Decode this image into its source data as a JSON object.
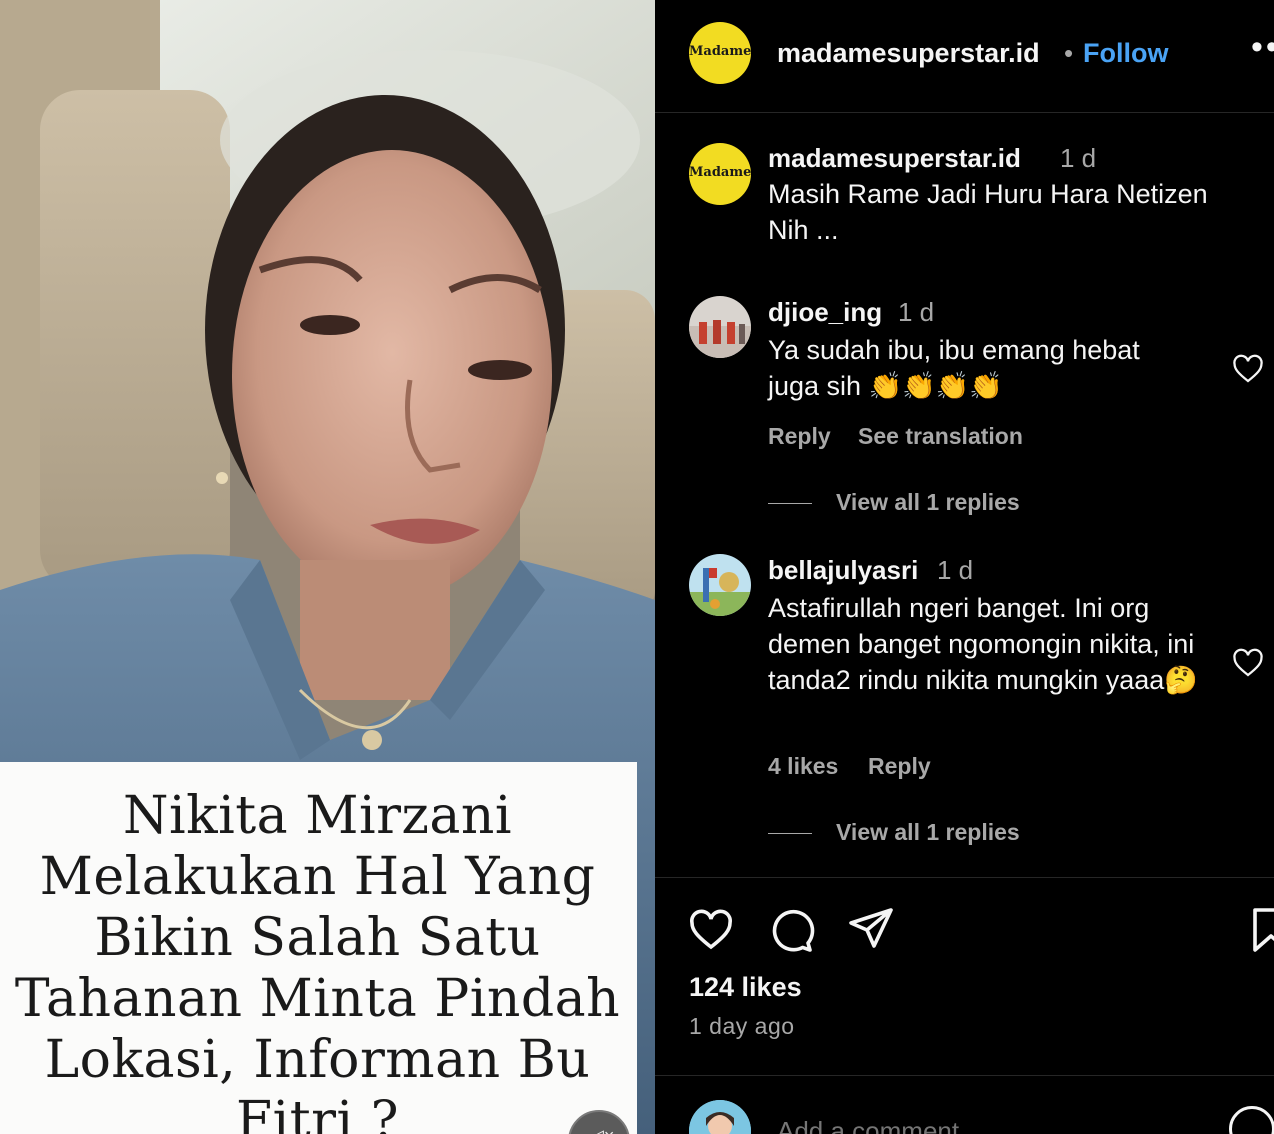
{
  "media": {
    "caption_card_text": "Nikita Mirzani\nMelakukan Hal Yang\nBikin Salah Satu\nTahanan Minta Pindah\nLokasi, Informan Bu\nFitri ?"
  },
  "header": {
    "logo_text": "Madame",
    "username": "madamesuperstar.id",
    "separator": "•",
    "follow_label": "Follow",
    "more_label": "••"
  },
  "post_caption": {
    "username": "madamesuperstar.id",
    "time": "1 d",
    "text": "Masih Rame Jadi Huru Hara Netizen Nih ..."
  },
  "comments": [
    {
      "username": "djioe_ing",
      "time": "1 d",
      "text": "Ya sudah ibu, ibu emang hebat juga sih 👏👏👏👏",
      "actions": [
        "Reply",
        "See translation"
      ],
      "view_replies": "View all 1 replies"
    },
    {
      "username": "bellajulyasri",
      "time": "1 d",
      "text": "Astafirullah ngeri banget. Ini org demen banget ngomongin nikita, ini tanda2 rindu nikita mungkin yaaa🤔",
      "actions": [
        "4 likes",
        "Reply"
      ],
      "view_replies": "View all 1 replies"
    }
  ],
  "actions_bar": {
    "icons": [
      "heart-icon",
      "comment-icon",
      "share-icon",
      "bookmark-icon"
    ],
    "likes": "124 likes",
    "posted": "1 day ago"
  },
  "composer": {
    "placeholder": "Add a comment..."
  },
  "colors": {
    "background": "#000000",
    "accent": "#4aa3f5",
    "muted": "#a8a8a8",
    "logo_yellow": "#f2dc22"
  }
}
